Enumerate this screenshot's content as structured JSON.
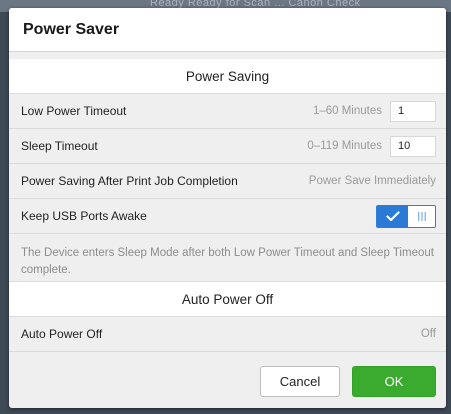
{
  "backdrop": {
    "text": "Ready   Ready for Scan ... Canon Check"
  },
  "dialog": {
    "title": "Power Saver",
    "power_saving": {
      "section_title": "Power Saving",
      "low_power_timeout": {
        "label": "Low Power Timeout",
        "range": "1–60 Minutes",
        "value": "1"
      },
      "sleep_timeout": {
        "label": "Sleep Timeout",
        "range": "0–119 Minutes",
        "value": "10"
      },
      "after_print": {
        "label": "Power Saving After Print Job Completion",
        "value": "Power Save Immediately"
      },
      "keep_usb": {
        "label": "Keep USB Ports Awake",
        "state": "on"
      },
      "note": "The Device enters Sleep Mode after both Low Power Timeout and Sleep Timeout complete."
    },
    "auto_power_off": {
      "section_title": "Auto Power Off",
      "row": {
        "label": "Auto Power Off",
        "value": "Off"
      }
    },
    "buttons": {
      "cancel": "Cancel",
      "ok": "OK"
    }
  },
  "colors": {
    "accent_blue": "#2b7bd6",
    "ok_green": "#3aab2f"
  }
}
